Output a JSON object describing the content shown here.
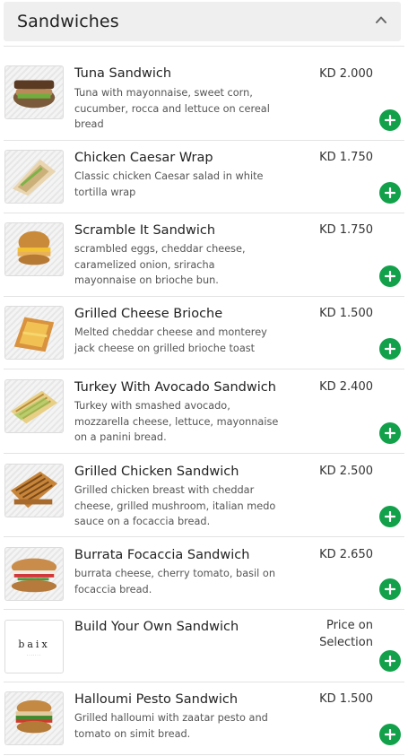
{
  "section": {
    "title": "Sandwiches",
    "collapse_icon": "chevron-up-icon"
  },
  "colors": {
    "add_button": "#12a14a",
    "header_bg": "#efefef"
  },
  "items": [
    {
      "name": "Tuna Sandwich",
      "description": "Tuna with mayonnaise, sweet corn, cucumber, rocca and lettuce on cereal bread",
      "price": "KD 2.000"
    },
    {
      "name": "Chicken Caesar Wrap",
      "description": "Classic chicken Caesar salad in white tortilla wrap",
      "price": "KD 1.750"
    },
    {
      "name": "Scramble It Sandwich",
      "description": "scrambled eggs, cheddar cheese, caramelized onion, sriracha mayonnaise on brioche bun.",
      "price": "KD 1.750"
    },
    {
      "name": "Grilled Cheese Brioche",
      "description": "Melted cheddar cheese and monterey jack cheese on grilled brioche toast",
      "price": "KD 1.500"
    },
    {
      "name": "Turkey With Avocado Sandwich",
      "description": "Turkey with smashed avocado, mozzarella cheese, lettuce, mayonnaise on a panini bread.",
      "price": "KD 2.400"
    },
    {
      "name": "Grilled Chicken Sandwich",
      "description": "Grilled chicken breast with cheddar cheese, grilled mushroom, italian medo sauce on a focaccia bread.",
      "price": "KD 2.500"
    },
    {
      "name": "Burrata Focaccia Sandwich",
      "description": "burrata cheese, cherry tomato, basil on focaccia bread.",
      "price": "KD 2.650"
    },
    {
      "name": "Build Your Own Sandwich",
      "description": "",
      "price": "Price on Selection",
      "logo_text": "baix"
    },
    {
      "name": "Halloumi Pesto Sandwich",
      "description": "Grilled halloumi with zaatar pesto and tomato on simit bread.",
      "price": "KD 1.500"
    }
  ]
}
